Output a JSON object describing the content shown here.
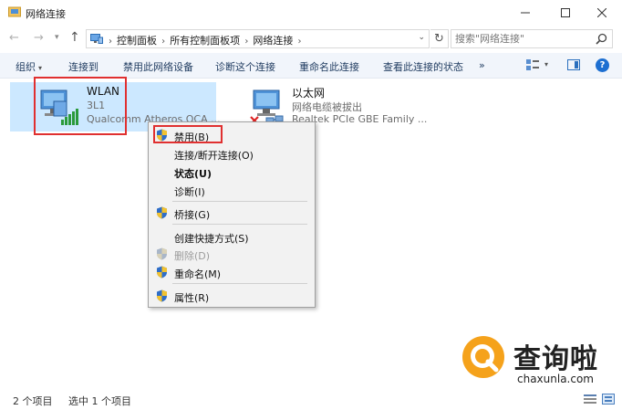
{
  "window": {
    "title": "网络连接"
  },
  "address": {
    "crumbs": [
      "控制面板",
      "所有控制面板项",
      "网络连接"
    ],
    "search_placeholder": "搜索\"网络连接\""
  },
  "commands": {
    "organize": "组织",
    "connect_to": "连接到",
    "disable_device": "禁用此网络设备",
    "diagnose": "诊断这个连接",
    "rename": "重命名此连接",
    "view_status": "查看此连接的状态",
    "more": "»"
  },
  "items": [
    {
      "name": "WLAN",
      "sub1": "3L1",
      "sub2": "Qualcomm Atheros QCA ..."
    },
    {
      "name": "以太网",
      "sub1": "网络电缆被拔出",
      "sub2": "Realtek PCIe GBE Family ..."
    }
  ],
  "context_menu": {
    "disable": "禁用(B)",
    "connect_disconnect": "连接/断开连接(O)",
    "status": "状态(U)",
    "diagnose": "诊断(I)",
    "bridge": "桥接(G)",
    "create_shortcut": "创建快捷方式(S)",
    "delete": "删除(D)",
    "rename": "重命名(M)",
    "properties": "属性(R)"
  },
  "status": {
    "count": "2 个项目",
    "selected": "选中 1 个项目"
  },
  "watermark": {
    "zh": "查询啦",
    "en": "chaxunla.com"
  },
  "colors": {
    "selection": "#cce8ff",
    "highlight_box": "#e03030",
    "accent": "#1d6fd1",
    "watermark_orange": "#f5a21b"
  }
}
